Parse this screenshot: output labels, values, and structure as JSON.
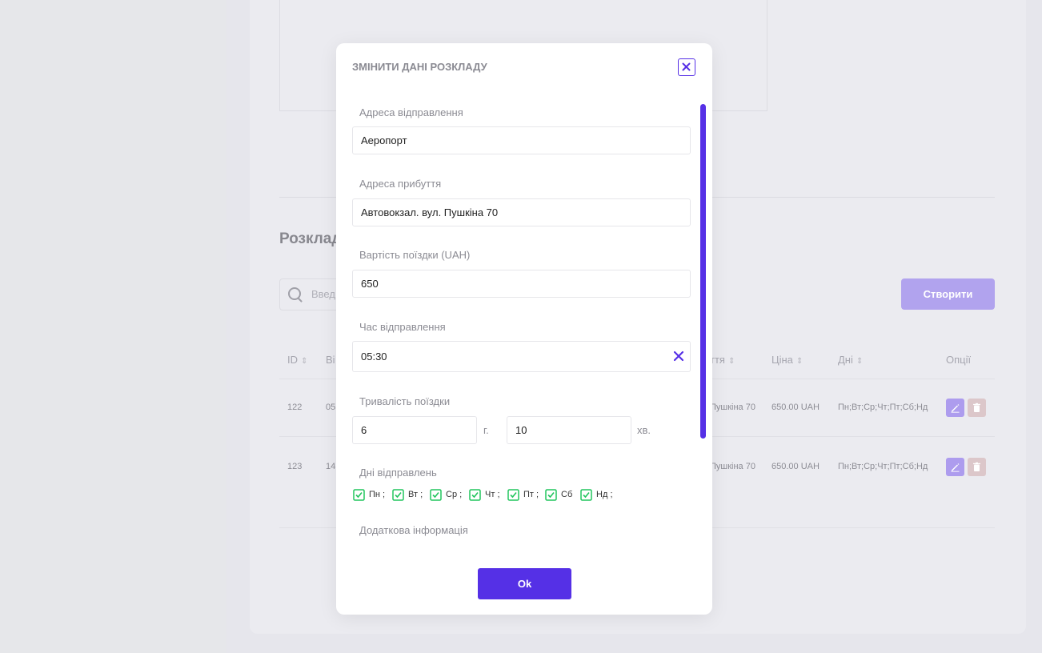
{
  "background": {
    "section_title": "Розклад",
    "search_placeholder": "Введ",
    "create_label": "Створити",
    "table": {
      "headers": [
        {
          "label": "ID",
          "sortable": true
        },
        {
          "label": "Ві",
          "sortable": false
        },
        {
          "label": "ття",
          "sortable": true
        },
        {
          "label": "Ціна",
          "sortable": true
        },
        {
          "label": "Дні",
          "sortable": true
        },
        {
          "label": "Опції",
          "sortable": false
        }
      ],
      "rows": [
        {
          "id": "122",
          "departure": "05",
          "arrival": "Пушкіна 70",
          "price": "650.00 UAH",
          "days": "Пн;Вт;Ср;Чт;Пт;Сб;Нд"
        },
        {
          "id": "123",
          "departure": "14",
          "arrival": "Пушкіна 70",
          "price": "650.00 UAH",
          "days": "Пн;Вт;Ср;Чт;Пт;Сб;Нд"
        }
      ]
    }
  },
  "modal": {
    "title": "ЗМІНИТИ ДАНІ РОЗКЛАДУ",
    "departure_label": "Адреса відправлення",
    "departure_value": "Аеропорт",
    "arrival_label": "Адреса прибуття",
    "arrival_value": "Автовокзал. вул. Пушкіна 70",
    "price_label": "Вартість поїздки (UAH)",
    "price_value": "650",
    "time_label": "Час відправлення",
    "time_value": "05:30",
    "duration_label": "Тривалість поїздки",
    "duration_hours": "6",
    "hours_unit": "г.",
    "duration_minutes": "10",
    "minutes_unit": "хв.",
    "days_label": "Дні відправлень",
    "days": [
      {
        "label": "Пн",
        "checked": true
      },
      {
        "label": "Вт",
        "checked": true
      },
      {
        "label": "Ср",
        "checked": true
      },
      {
        "label": "Чт",
        "checked": true
      },
      {
        "label": "Пт",
        "checked": true
      },
      {
        "label": "Сб",
        "checked": true
      },
      {
        "label": "Нд",
        "checked": true
      }
    ],
    "day_separator": ";",
    "extra_label": "Додаткова інформація",
    "ok_label": "Ok"
  },
  "colors": {
    "accent": "#5530e6",
    "accent_light": "#b1a3ee",
    "check": "#22c55e"
  }
}
